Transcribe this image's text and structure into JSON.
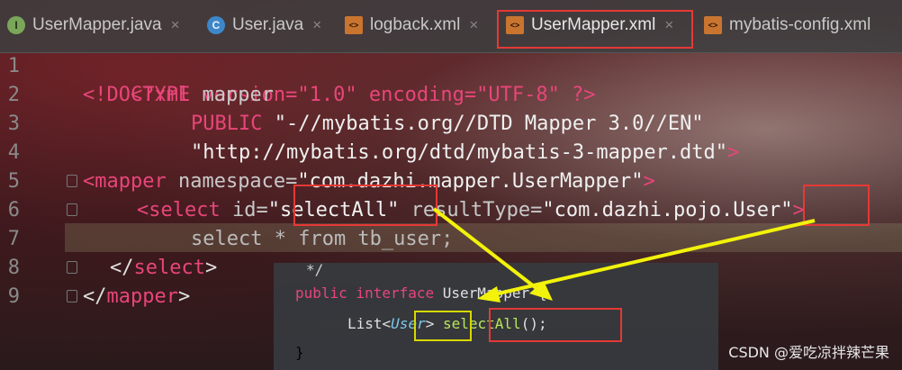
{
  "tabs": [
    {
      "label": "UserMapper.java",
      "icon": "I",
      "kind": "interface"
    },
    {
      "label": "User.java",
      "icon": "C",
      "kind": "class"
    },
    {
      "label": "logback.xml",
      "icon": "<>",
      "kind": "xml"
    },
    {
      "label": "UserMapper.xml",
      "icon": "<>",
      "kind": "xml"
    },
    {
      "label": "mybatis-config.xml",
      "icon": "<>",
      "kind": "xml"
    }
  ],
  "close_glyph": "×",
  "line_numbers": [
    "1",
    "2",
    "3",
    "4",
    "5",
    "6",
    "7",
    "8",
    "9"
  ],
  "code": {
    "l1": {
      "decl": "<?xml version=\"1.0\" encoding=\"UTF-8\" ?>"
    },
    "l2": {
      "a": "<!DOCTYPE",
      "b": " mapper"
    },
    "l3": {
      "a": "PUBLIC",
      "b": " \"-//mybatis.org//DTD Mapper 3.0//EN\""
    },
    "l4": {
      "a": "\"http://mybatis.org/dtd/mybatis-3-mapper.dtd\"",
      "b": ">"
    },
    "l5": {
      "a": "<mapper",
      "b": " namespace=",
      "c": "\"com.dazhi.mapper.UserMapper\"",
      "d": ">"
    },
    "l6": {
      "a": "<select",
      "b": " id=",
      "c": "\"selectAll\"",
      "d": " resultType=",
      "e": "\"com.dazhi.pojo.User\"",
      "f": ">"
    },
    "l7": {
      "a": "select * from tb_user;"
    },
    "l8": {
      "a": "</",
      "b": "select",
      "c": ">"
    },
    "l9": {
      "a": "</",
      "b": "mapper",
      "c": ">"
    }
  },
  "popup": {
    "comment": "*/",
    "l1a": "public interface",
    "l1b": " UserMapper {",
    "l2a": "List<",
    "l2b": "User",
    "l2c": ">",
    "l2d": "selectAll",
    "l2e": "();",
    "l3": "}"
  },
  "watermark": "CSDN @爱吃凉拌辣芒果",
  "colors": {
    "highlight_box": "#e53935",
    "arrow": "#f2f20a",
    "tag": "#e8457a"
  }
}
